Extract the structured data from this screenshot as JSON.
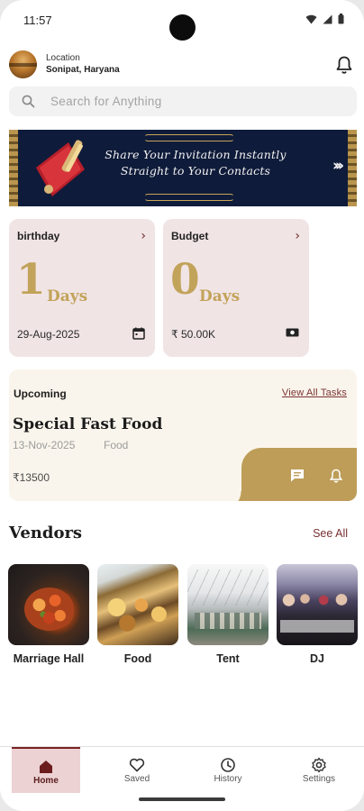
{
  "status_bar": {
    "time": "11:57"
  },
  "header": {
    "location_label": "Location",
    "location_value": "Sonipat, Haryana"
  },
  "search": {
    "placeholder": "Search for Anything"
  },
  "banner": {
    "line1": "Share Your Invitation Instantly",
    "line2": "Straight to Your Contacts",
    "arrows": "›››"
  },
  "cards": [
    {
      "title": "birthday",
      "number": "1",
      "unit": "Days",
      "sub": "29-Aug-2025",
      "icon": "calendar-icon"
    },
    {
      "title": "Budget",
      "number": "0",
      "unit": "Days",
      "sub": "₹ 50.00K",
      "icon": "money-icon"
    }
  ],
  "upcoming": {
    "header": "Upcoming",
    "view_all": "View All Tasks",
    "event_title": "Special Fast Food",
    "date": "13-Nov-2025",
    "category": "Food",
    "price": "₹13500"
  },
  "vendors": {
    "title": "Vendors",
    "see_all": "See All",
    "items": [
      {
        "label": "Marriage Hall"
      },
      {
        "label": "Food"
      },
      {
        "label": "Tent"
      },
      {
        "label": "DJ"
      }
    ]
  },
  "bottom_nav": {
    "active": "Home",
    "items": [
      {
        "label": "Home",
        "icon": "home-icon"
      },
      {
        "label": "Saved",
        "icon": "heart-icon"
      },
      {
        "label": "History",
        "icon": "history-icon"
      },
      {
        "label": "Settings",
        "icon": "gear-icon"
      }
    ]
  },
  "colors": {
    "gold": "#bd9d58",
    "card_pink": "#f1e4e5",
    "upcoming_bg": "#faf5ec",
    "maroon": "#7a3232",
    "banner_navy": "#0f1b3a"
  }
}
